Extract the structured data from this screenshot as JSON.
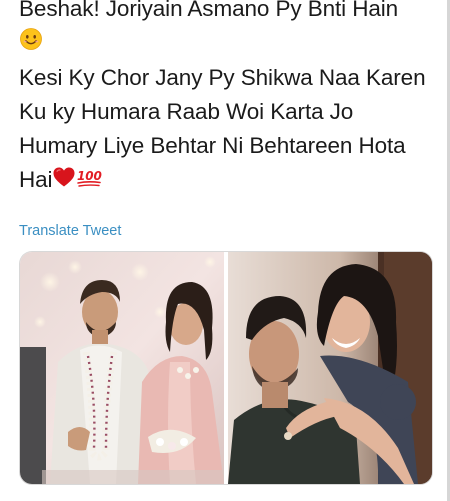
{
  "tweet": {
    "text_lines": [
      "Beshak! Joriyain Asmano Py Bnti Hain",
      "",
      "Kesi Ky Chor Jany Py Shikwa Naa Karen",
      "Ku ky Humara Raab Woi Karta Jo",
      "Humary Liye Behtar Ni Behtareen Hota",
      "Hai"
    ],
    "emojis": [
      "smiling-face-emoji",
      "red-heart-emoji",
      "hundred-points-emoji"
    ],
    "hundred_label": "100",
    "translate_label": "Translate Tweet",
    "media": [
      {
        "name": "tweet-photo-1",
        "description_icon": "photo"
      },
      {
        "name": "tweet-photo-2",
        "description_icon": "photo"
      }
    ]
  },
  "colors": {
    "text": "#1b1b1b",
    "link": "#3b8fc2",
    "border": "#d8d8d8"
  }
}
